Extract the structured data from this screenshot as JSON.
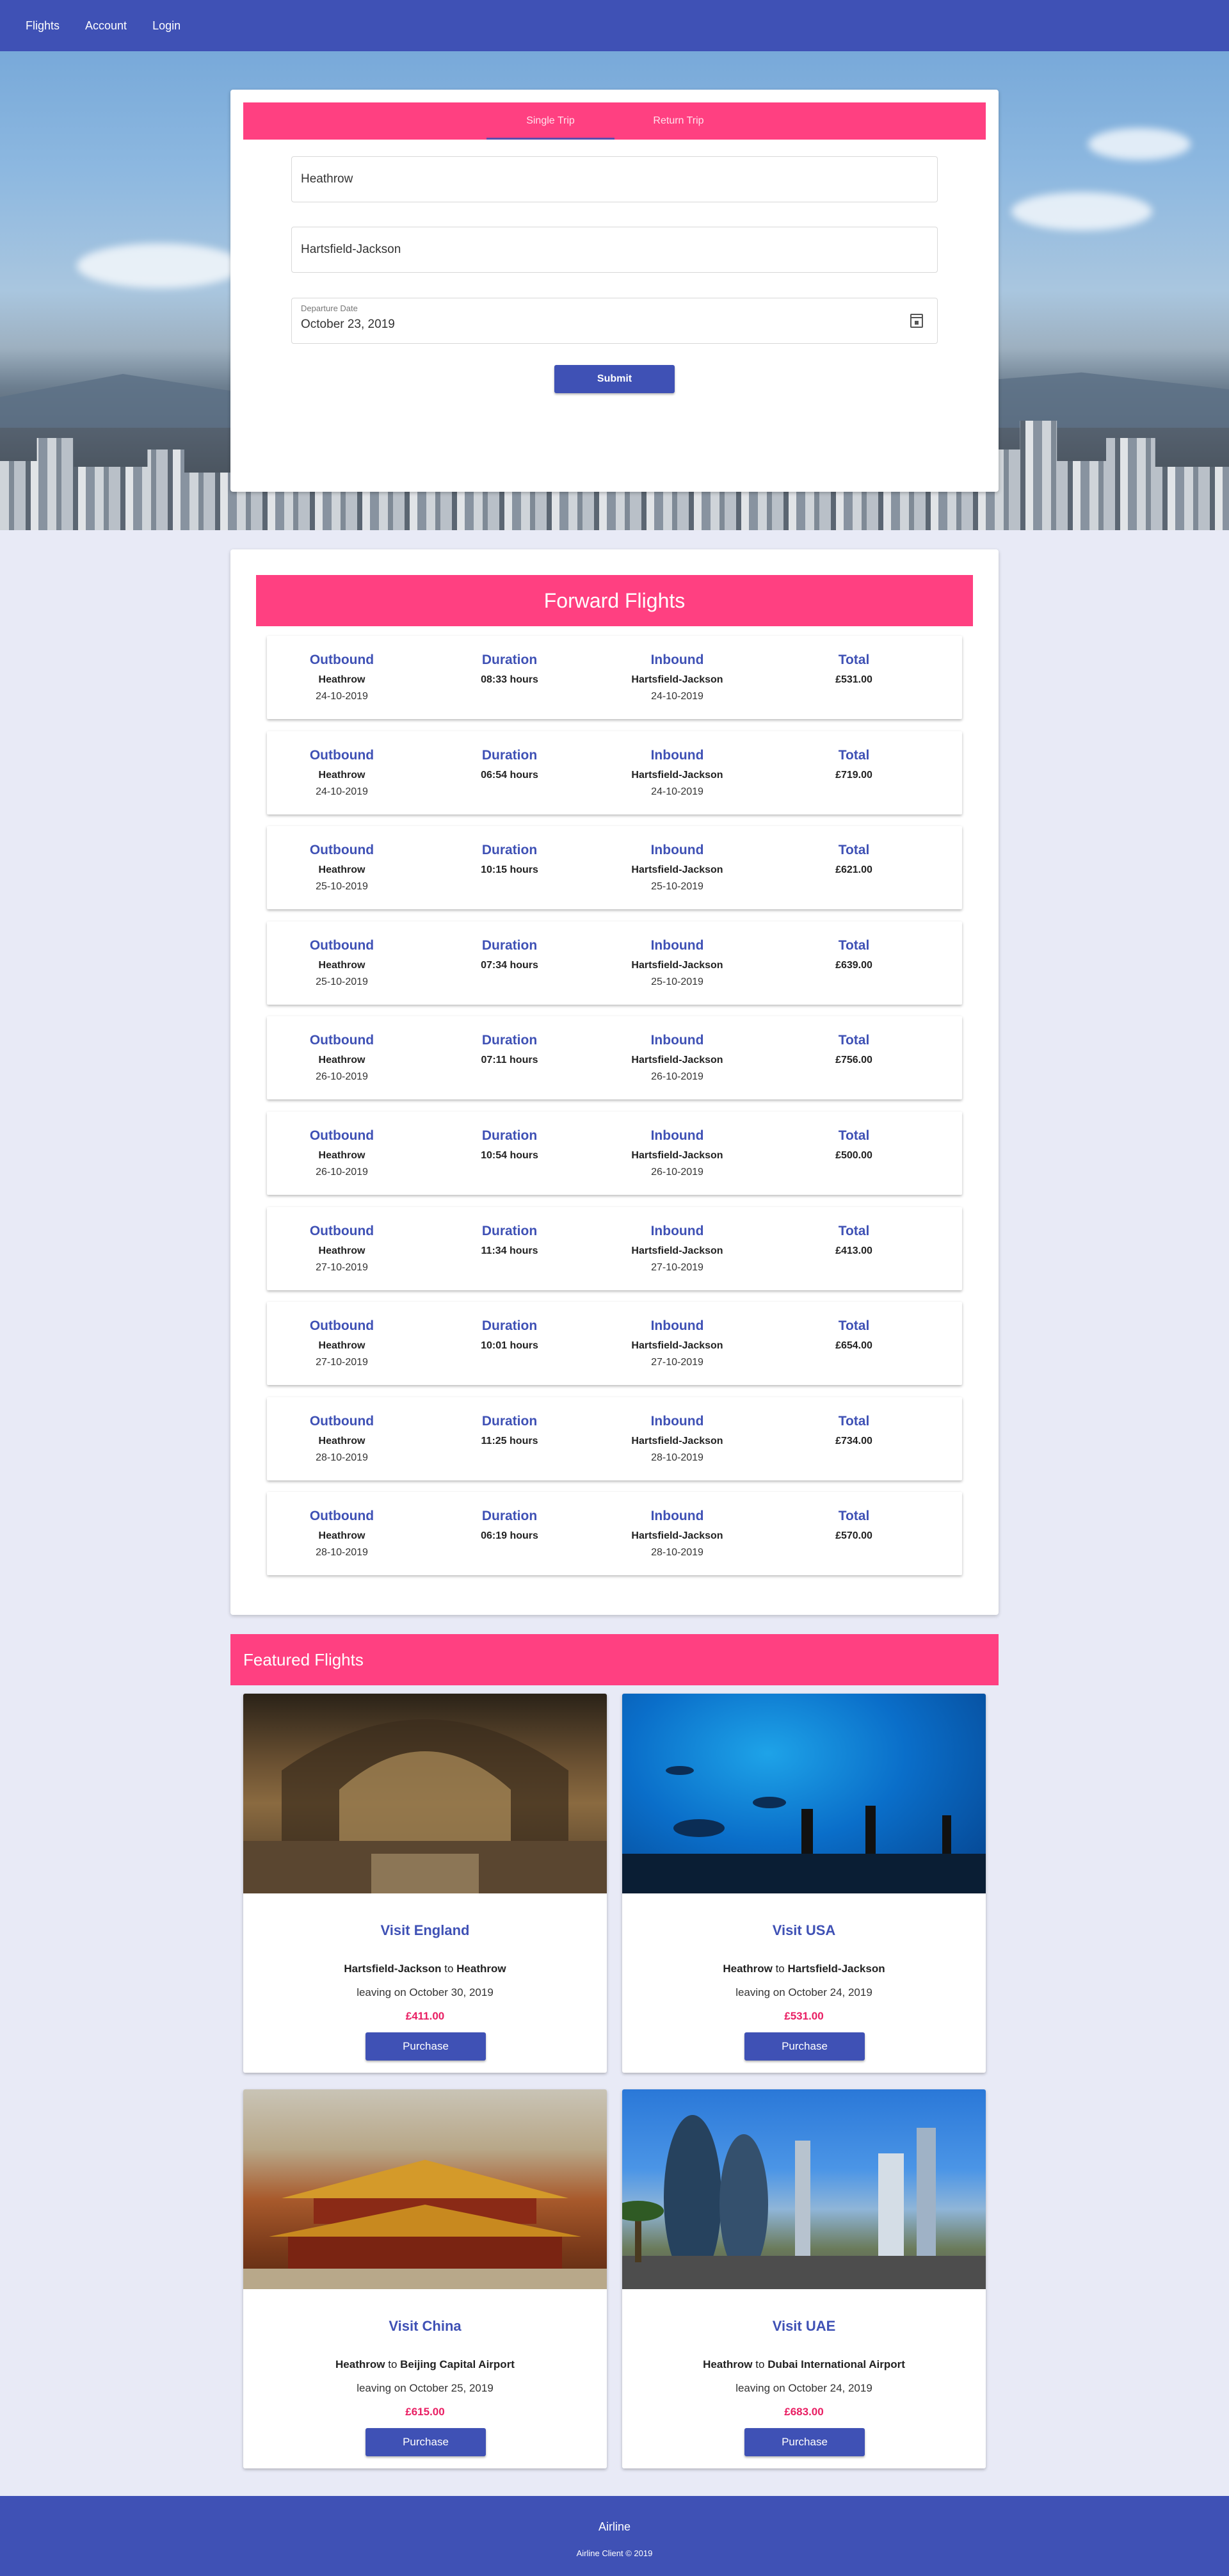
{
  "nav": {
    "items": [
      "Flights",
      "Account",
      "Login"
    ]
  },
  "search": {
    "tabs": [
      "Single Trip",
      "Return Trip"
    ],
    "active_tab": "Single Trip",
    "origin": "Heathrow",
    "destination": "Hartsfield-Jackson",
    "date_label": "Departure Date",
    "date_value": "October 23, 2019",
    "submit_label": "Submit"
  },
  "forward": {
    "title": "Forward Flights",
    "headers": {
      "outbound": "Outbound",
      "duration": "Duration",
      "inbound": "Inbound",
      "total": "Total"
    },
    "flights": [
      {
        "from": "Heathrow",
        "from_date": "24-10-2019",
        "duration": "08:33 hours",
        "to": "Hartsfield-Jackson",
        "to_date": "24-10-2019",
        "total": "£531.00"
      },
      {
        "from": "Heathrow",
        "from_date": "24-10-2019",
        "duration": "06:54 hours",
        "to": "Hartsfield-Jackson",
        "to_date": "24-10-2019",
        "total": "£719.00"
      },
      {
        "from": "Heathrow",
        "from_date": "25-10-2019",
        "duration": "10:15 hours",
        "to": "Hartsfield-Jackson",
        "to_date": "25-10-2019",
        "total": "£621.00"
      },
      {
        "from": "Heathrow",
        "from_date": "25-10-2019",
        "duration": "07:34 hours",
        "to": "Hartsfield-Jackson",
        "to_date": "25-10-2019",
        "total": "£639.00"
      },
      {
        "from": "Heathrow",
        "from_date": "26-10-2019",
        "duration": "07:11 hours",
        "to": "Hartsfield-Jackson",
        "to_date": "26-10-2019",
        "total": "£756.00"
      },
      {
        "from": "Heathrow",
        "from_date": "26-10-2019",
        "duration": "10:54 hours",
        "to": "Hartsfield-Jackson",
        "to_date": "26-10-2019",
        "total": "£500.00"
      },
      {
        "from": "Heathrow",
        "from_date": "27-10-2019",
        "duration": "11:34 hours",
        "to": "Hartsfield-Jackson",
        "to_date": "27-10-2019",
        "total": "£413.00"
      },
      {
        "from": "Heathrow",
        "from_date": "27-10-2019",
        "duration": "10:01 hours",
        "to": "Hartsfield-Jackson",
        "to_date": "27-10-2019",
        "total": "£654.00"
      },
      {
        "from": "Heathrow",
        "from_date": "28-10-2019",
        "duration": "11:25 hours",
        "to": "Hartsfield-Jackson",
        "to_date": "28-10-2019",
        "total": "£734.00"
      },
      {
        "from": "Heathrow",
        "from_date": "28-10-2019",
        "duration": "06:19 hours",
        "to": "Hartsfield-Jackson",
        "to_date": "28-10-2019",
        "total": "£570.00"
      }
    ]
  },
  "featured": {
    "title": "Featured Flights",
    "connector": "to",
    "cards": [
      {
        "title": "Visit England",
        "from": "Hartsfield-Jackson",
        "to": "Heathrow",
        "date": "leaving on October 30, 2019",
        "price": "£411.00",
        "button": "Purchase",
        "image": "museum-hall-image"
      },
      {
        "title": "Visit USA",
        "from": "Heathrow",
        "to": "Hartsfield-Jackson",
        "date": "leaving on October 24, 2019",
        "price": "£531.00",
        "button": "Purchase",
        "image": "aquarium-image"
      },
      {
        "title": "Visit China",
        "from": "Heathrow",
        "to": "Beijing Capital Airport",
        "date": "leaving on October 25, 2019",
        "price": "£615.00",
        "button": "Purchase",
        "image": "forbidden-city-image"
      },
      {
        "title": "Visit UAE",
        "from": "Heathrow",
        "to": "Dubai International Airport",
        "date": "leaving on October 24, 2019",
        "price": "£683.00",
        "button": "Purchase",
        "image": "dubai-skyline-image"
      }
    ]
  },
  "footer": {
    "title": "Airline",
    "copyright": "Airline Client © 2019"
  },
  "colors": {
    "primary": "#3f51b5",
    "accent": "#ff4081",
    "price": "#e91e63",
    "background": "#e8eaf6"
  }
}
